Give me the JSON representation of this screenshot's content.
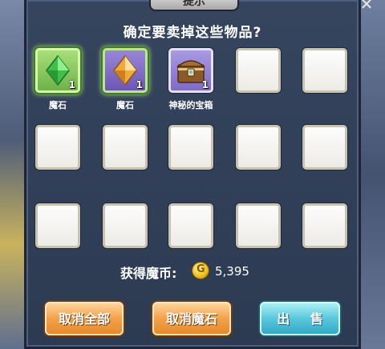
{
  "dialog": {
    "title": "提示",
    "close_symbol": "✕",
    "question": "确定要卖掉这些物品?"
  },
  "items": [
    {
      "label": "魔石",
      "qty": "1",
      "type": "green-gem",
      "icon": "green-crystal-icon"
    },
    {
      "label": "魔石",
      "qty": "1",
      "type": "purple-gem",
      "icon": "orange-crystal-icon"
    },
    {
      "label": "神秘的宝箱",
      "qty": "1",
      "type": "chest",
      "icon": "treasure-chest-icon"
    }
  ],
  "gain": {
    "label": "获得魔币:",
    "coin_glyph": "G",
    "amount": "5,395"
  },
  "buttons": {
    "cancel_all": "取消全部",
    "cancel_gem": "取消魔石",
    "sell": "出 售"
  },
  "colors": {
    "dialog_bg": "#2c3a52",
    "slot_bg": "#f4f3ee",
    "button_orange": "#f2a24a",
    "button_teal": "#5ac7dc",
    "gem_selected_border": "#a3e06a"
  }
}
